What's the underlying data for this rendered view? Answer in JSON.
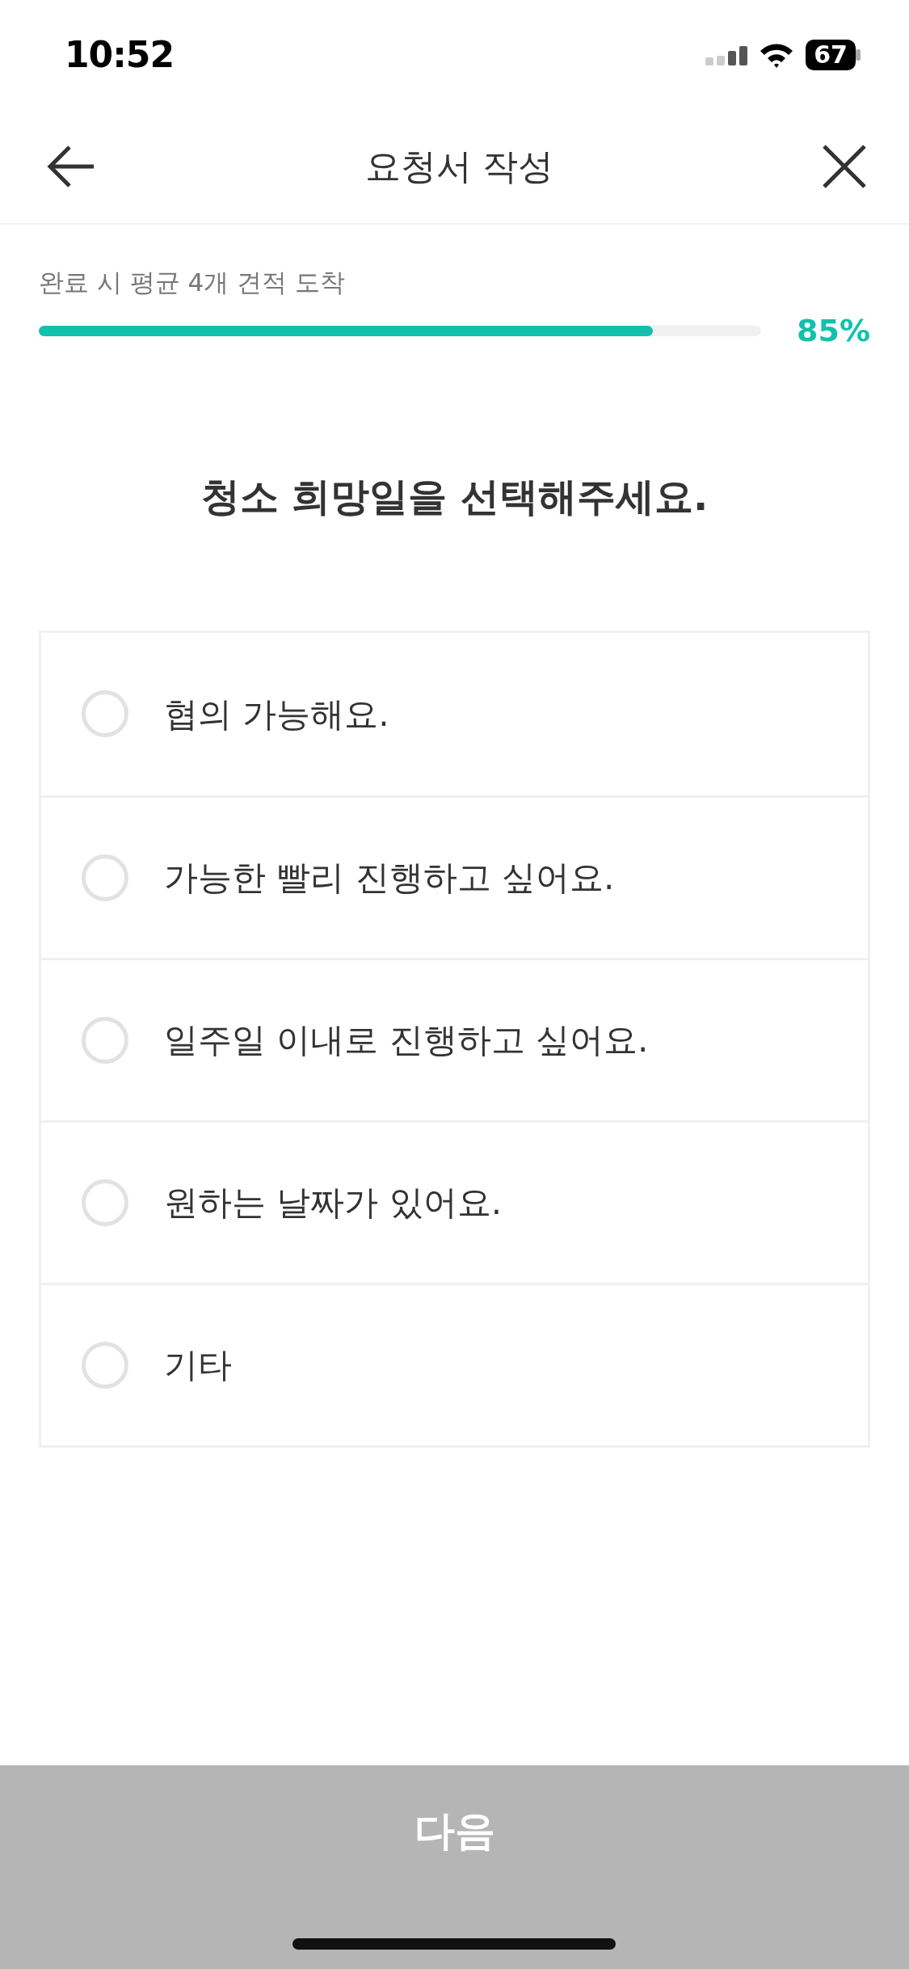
{
  "status_bar": {
    "time": "10:52",
    "battery": "67"
  },
  "header": {
    "title": "요청서 작성"
  },
  "progress": {
    "label": "완료 시 평균 4개 견적 도착",
    "level": 0.85,
    "reading": "85%"
  },
  "question": "청소 희망일을 선택해주세요.",
  "options": [
    {
      "label": "협의 가능해요.",
      "selected": false
    },
    {
      "label": "가능한 빨리 진행하고 싶어요.",
      "selected": false
    },
    {
      "label": "일주일 이내로 진행하고 싶어요.",
      "selected": false
    },
    {
      "label": "원하는 날짜가 있어요.",
      "selected": false
    },
    {
      "label": "기타",
      "selected": false
    }
  ],
  "next_button": {
    "label": "다음",
    "disabled": true
  }
}
